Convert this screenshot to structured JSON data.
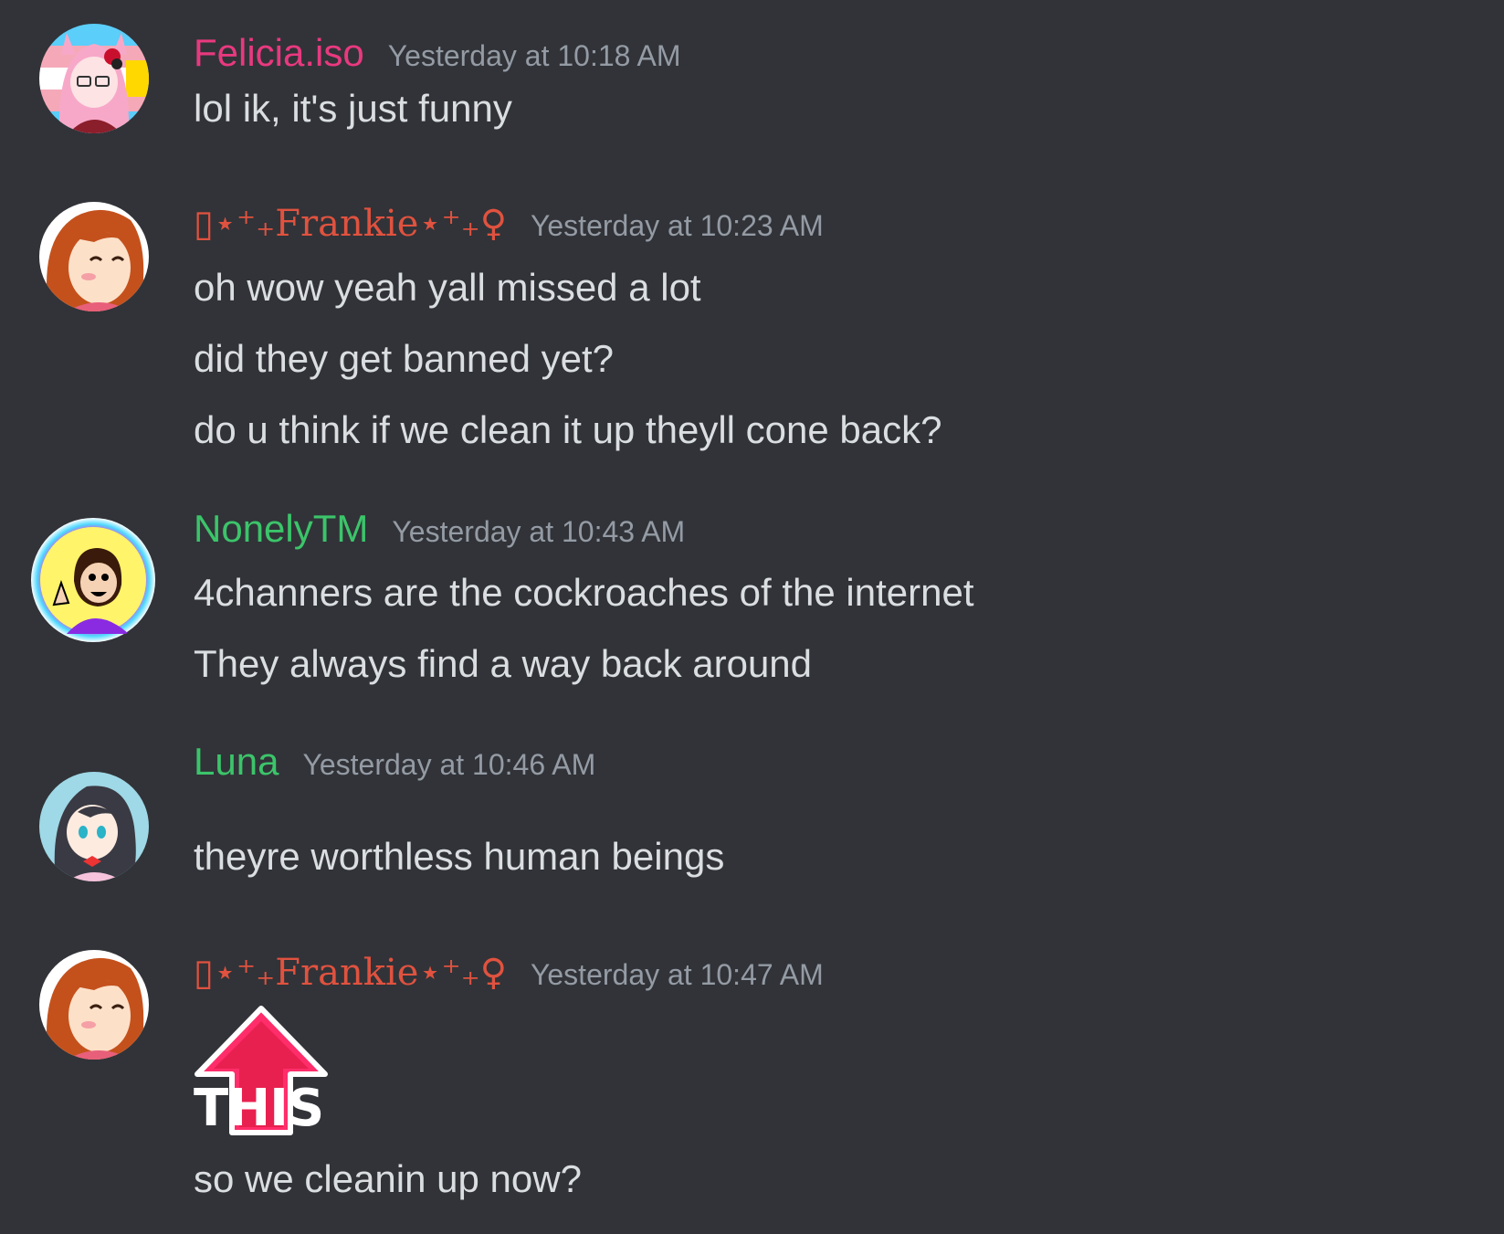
{
  "colors": {
    "background": "#313338",
    "text": "#dbdee1",
    "timestamp": "#949ba4",
    "felicia": "#e8397f",
    "frankie": "#e0523f",
    "green": "#3cc46a"
  },
  "messages": [
    {
      "username": "Felicia.iso",
      "timestamp": "Yesterday at 10:18 AM",
      "lines": [
        "lol ik, it's just funny"
      ]
    },
    {
      "username": "▯⋆⁺₊Frankie⋆⁺₊♀",
      "timestamp": "Yesterday at 10:23 AM",
      "lines": [
        "oh wow yeah yall missed a lot",
        "did they get banned yet?",
        "do u think if we clean it up theyll cone back?"
      ]
    },
    {
      "username": "NonelyTM",
      "timestamp": "Yesterday at 10:43 AM",
      "lines": [
        "4channers are the cockroaches of the internet",
        "They always find a way back around"
      ]
    },
    {
      "username": "Luna",
      "timestamp": "Yesterday at 10:46 AM",
      "lines": [
        "theyre worthless human beings"
      ]
    },
    {
      "username": "▯⋆⁺₊Frankie⋆⁺₊♀",
      "timestamp": "Yesterday at 10:47 AM",
      "sticker_text": "THIS",
      "lines": [
        "so we cleanin up now?"
      ]
    }
  ]
}
